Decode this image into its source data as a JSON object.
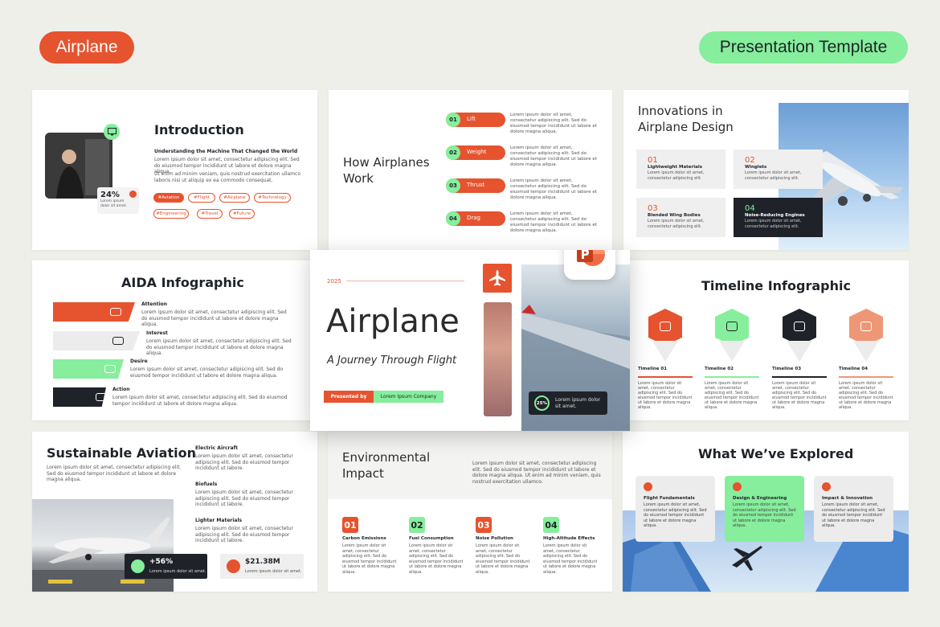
{
  "header": {
    "brand": "Airplane",
    "template_label": "Presentation Template"
  },
  "colors": {
    "orange": "#e6532f",
    "green": "#86ee9c",
    "dark": "#1f2329",
    "peach": "#ee9777",
    "bg": "#efefea"
  },
  "lorem": {
    "short": "Lorem ipsum dolor sit amet, consectetur adipiscing elit.",
    "two": "Lorem ipsum dolor sit amet, consectetur adipiscing elit. Sed do eiusmod tempor incididunt ut labore et dolore magna aliqua.",
    "block": "Lorem ipsum dolor sit amet, consectetur adipiscing elit. Sed do eiusmod tempor incididunt ut labore et dolore magna aliqua."
  },
  "intro": {
    "title": "Introduction",
    "subtitle": "Understanding the Machine That Changed the World",
    "p1": "Lorem ipsum dolor sit amet, consectetur adipiscing elit. Sed do eiusmod tempor incididunt ut labore et dolore magna aliqua.",
    "p2": "Ut enim ad minim veniam, quis nostrud exercitation ullamco laboris nisi ut aliquip ex ea commodo consequat.",
    "stat": "24%",
    "stat_text": "Lorem ipsum dolor sit amet.",
    "tags": [
      "#Aviation",
      "#Flight",
      "#Airplane",
      "#Technology",
      "#Engineering",
      "#Travel",
      "#Future"
    ]
  },
  "how": {
    "title": "How Airplanes Work",
    "items": [
      {
        "num": "01",
        "label": "Lift"
      },
      {
        "num": "02",
        "label": "Weight"
      },
      {
        "num": "03",
        "label": "Thrust"
      },
      {
        "num": "04",
        "label": "Drag"
      }
    ]
  },
  "innov": {
    "title": "Innovations in Airplane Design",
    "items": [
      {
        "num": "01",
        "label": "Lightweight Materials",
        "text": "Lorem ipsum dolor sit amet, consectetur adipiscing elit."
      },
      {
        "num": "02",
        "label": "Winglets",
        "text": "Lorem ipsum dolor sit amet, consectetur adipiscing elit."
      },
      {
        "num": "03",
        "label": "Blended Wing Bodies",
        "text": "Lorem ipsum dolor sit amet, consectetur adipiscing elit."
      },
      {
        "num": "04",
        "label": "Noise-Reducing Engines",
        "text": "Lorem ipsum dolor sit amet, consectetur adipiscing elit."
      }
    ]
  },
  "aida": {
    "title": "AIDA Infographic",
    "items": [
      {
        "label": "Attention",
        "text": "Lorem ipsum dolor sit amet, consectetur adipiscing elit. Sed do eiusmod tempor incididunt ut labore et dolore magna aliqua."
      },
      {
        "label": "Interest",
        "text": "Lorem ipsum dolor sit amet, consectetur adipiscing elit. Sed do eiusmod tempor incididunt ut labore et dolore magna aliqua."
      },
      {
        "label": "Desire",
        "text": "Lorem ipsum dolor sit amet, consectetur adipiscing elit. Sed do eiusmod tempor incididunt ut labore et dolore magna aliqua."
      },
      {
        "label": "Action",
        "text": "Lorem ipsum dolor sit amet, consectetur adipiscing elit. Sed do eiusmod tempor incididunt ut labore et dolore magna aliqua."
      }
    ]
  },
  "cover": {
    "year": "2025",
    "title": "Airplane",
    "subtitle": "A Journey Through Flight",
    "presented_by": "Presented by",
    "company": "Lorem Ipsum Company",
    "stat": "25%",
    "stat_text": "Lorem ipsum dolor sit amet."
  },
  "timeline": {
    "title": "Timeline Infographic",
    "items": [
      {
        "label": "Timeline 01",
        "text": "Lorem ipsum dolor sit amet, consectetur adipiscing elit. Sed do eiusmod tempor incididunt ut labore et dolore magna aliqua."
      },
      {
        "label": "Timeline 02",
        "text": "Lorem ipsum dolor sit amet, consectetur adipiscing elit. Sed do eiusmod tempor incididunt ut labore et dolore magna aliqua."
      },
      {
        "label": "Timeline 03",
        "text": "Lorem ipsum dolor sit amet, consectetur adipiscing elit. Sed do eiusmod tempor incididunt ut labore et dolore magna aliqua."
      },
      {
        "label": "Timeline 04",
        "text": "Lorem ipsum dolor sit amet, consectetur adipiscing elit. Sed do eiusmod tempor incididunt ut labore et dolore magna aliqua."
      }
    ]
  },
  "sustain": {
    "title": "Sustainable Aviation",
    "text": "Lorem ipsum dolor sit amet, consectetur adipiscing elit. Sed do eiusmod tempor incididunt ut labore et dolore magna aliqua.",
    "items": [
      {
        "label": "Electric Aircraft",
        "text": "Lorem ipsum dolor sit amet, consectetur adipiscing elit. Sed do eiusmod tempor incididunt ut labore."
      },
      {
        "label": "Biofuels",
        "text": "Lorem ipsum dolor sit amet, consectetur adipiscing elit. Sed do eiusmod tempor incididunt ut labore."
      },
      {
        "label": "Lighter Materials",
        "text": "Lorem ipsum dolor sit amet, consectetur adipiscing elit. Sed do eiusmod tempor incididunt ut labore."
      }
    ],
    "stat1": "+56%",
    "stat1_text": "Lorem ipsum dolor sit amet.",
    "stat2": "$21.38M",
    "stat2_text": "Lorem ipsum dolor sit amet."
  },
  "env": {
    "title": "Environmental Impact",
    "text": "Lorem ipsum dolor sit amet, consectetur adipiscing elit. Sed do eiusmod tempor incididunt ut labore et dolore magna aliqua. Ut enim ad minim veniam, quis nostrud exercitation ullamco.",
    "items": [
      {
        "num": "01",
        "label": "Carbon Emissions",
        "text": "Lorem ipsum dolor sit amet, consectetur adipiscing elit. Sed do eiusmod tempor incididunt ut labore et dolore magna aliqua."
      },
      {
        "num": "02",
        "label": "Fuel Consumption",
        "text": "Lorem ipsum dolor sit amet, consectetur adipiscing elit. Sed do eiusmod tempor incididunt ut labore et dolore magna aliqua."
      },
      {
        "num": "03",
        "label": "Noise Pollution",
        "text": "Lorem ipsum dolor sit amet, consectetur adipiscing elit. Sed do eiusmod tempor incididunt ut labore et dolore magna aliqua."
      },
      {
        "num": "04",
        "label": "High-Altitude Effects",
        "text": "Lorem ipsum dolor sit amet, consectetur adipiscing elit. Sed do eiusmod tempor incididunt ut labore et dolore magna aliqua."
      }
    ]
  },
  "explored": {
    "title": "What We’ve Explored",
    "items": [
      {
        "label": "Flight Fundamentals",
        "text": "Lorem ipsum dolor sit amet, consectetur adipiscing elit. Sed do eiusmod tempor incididunt ut labore et dolore magna aliqua."
      },
      {
        "label": "Design & Engineering",
        "text": "Lorem ipsum dolor sit amet, consectetur adipiscing elit. Sed do eiusmod tempor incididunt ut labore et dolore magna aliqua."
      },
      {
        "label": "Impact & Innovation",
        "text": "Lorem ipsum dolor sit amet, consectetur adipiscing elit. Sed do eiusmod tempor incididunt ut labore et dolore magna aliqua."
      }
    ]
  }
}
